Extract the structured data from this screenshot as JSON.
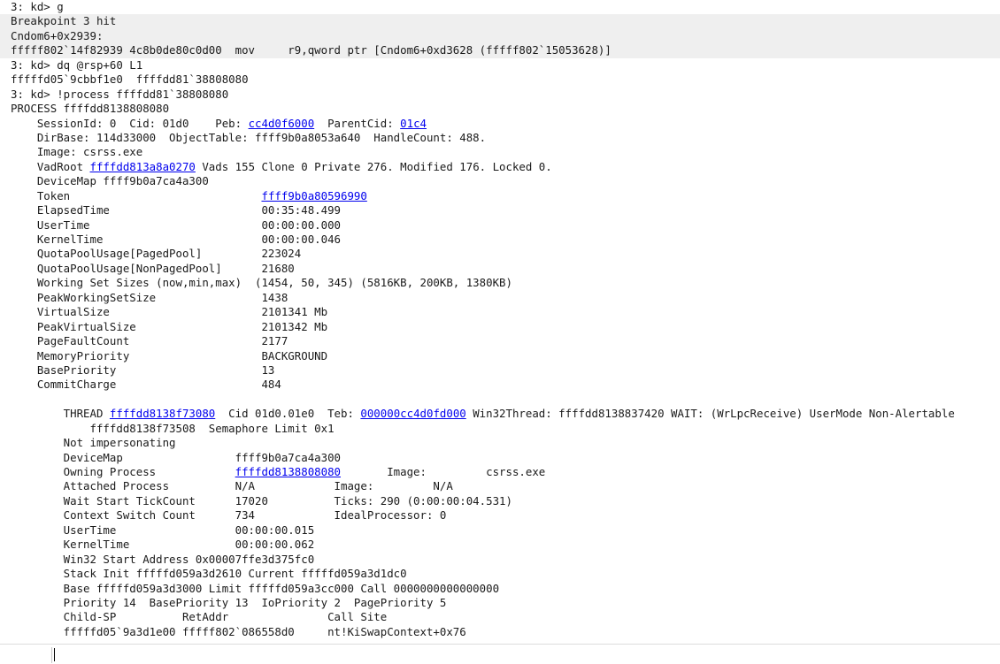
{
  "output_lines": [
    {
      "hl": false,
      "segs": [
        {
          "t": "3: kd> g"
        }
      ]
    },
    {
      "hl": true,
      "segs": [
        {
          "t": "Breakpoint 3 hit"
        }
      ]
    },
    {
      "hl": true,
      "segs": [
        {
          "t": "Cndom6+0x2939:"
        }
      ]
    },
    {
      "hl": true,
      "segs": [
        {
          "t": "fffff802`14f82939 4c8b0de80c0d00  mov     r9,qword ptr [Cndom6+0xd3628 (fffff802`15053628)]"
        }
      ]
    },
    {
      "hl": false,
      "segs": [
        {
          "t": "3: kd> dq @rsp+60 L1"
        }
      ]
    },
    {
      "hl": false,
      "segs": [
        {
          "t": "fffffd05`9cbbf1e0  ffffdd81`38808080"
        }
      ]
    },
    {
      "hl": false,
      "segs": [
        {
          "t": "3: kd> !process ffffdd81`38808080"
        }
      ]
    },
    {
      "hl": false,
      "segs": [
        {
          "t": "PROCESS ffffdd8138808080"
        }
      ]
    },
    {
      "hl": false,
      "segs": [
        {
          "t": "    SessionId: 0  Cid: 01d0    Peb: "
        },
        {
          "t": "cc4d0f6000",
          "link": true
        },
        {
          "t": "  ParentCid: "
        },
        {
          "t": "01c4",
          "link": true
        }
      ]
    },
    {
      "hl": false,
      "segs": [
        {
          "t": "    DirBase: 114d33000  ObjectTable: ffff9b0a8053a640  HandleCount: 488."
        }
      ]
    },
    {
      "hl": false,
      "segs": [
        {
          "t": "    Image: csrss.exe"
        }
      ]
    },
    {
      "hl": false,
      "segs": [
        {
          "t": "    VadRoot "
        },
        {
          "t": "ffffdd813a8a0270",
          "link": true
        },
        {
          "t": " Vads 155 Clone 0 Private 276. Modified 176. Locked 0."
        }
      ]
    },
    {
      "hl": false,
      "segs": [
        {
          "t": "    DeviceMap ffff9b0a7ca4a300"
        }
      ]
    },
    {
      "hl": false,
      "segs": [
        {
          "t": "    Token                             "
        },
        {
          "t": "ffff9b0a80596990",
          "link": true
        }
      ]
    },
    {
      "hl": false,
      "segs": [
        {
          "t": "    ElapsedTime                       00:35:48.499"
        }
      ]
    },
    {
      "hl": false,
      "segs": [
        {
          "t": "    UserTime                          00:00:00.000"
        }
      ]
    },
    {
      "hl": false,
      "segs": [
        {
          "t": "    KernelTime                        00:00:00.046"
        }
      ]
    },
    {
      "hl": false,
      "segs": [
        {
          "t": "    QuotaPoolUsage[PagedPool]         223024"
        }
      ]
    },
    {
      "hl": false,
      "segs": [
        {
          "t": "    QuotaPoolUsage[NonPagedPool]      21680"
        }
      ]
    },
    {
      "hl": false,
      "segs": [
        {
          "t": "    Working Set Sizes (now,min,max)  (1454, 50, 345) (5816KB, 200KB, 1380KB)"
        }
      ]
    },
    {
      "hl": false,
      "segs": [
        {
          "t": "    PeakWorkingSetSize                1438"
        }
      ]
    },
    {
      "hl": false,
      "segs": [
        {
          "t": "    VirtualSize                       2101341 Mb"
        }
      ]
    },
    {
      "hl": false,
      "segs": [
        {
          "t": "    PeakVirtualSize                   2101342 Mb"
        }
      ]
    },
    {
      "hl": false,
      "segs": [
        {
          "t": "    PageFaultCount                    2177"
        }
      ]
    },
    {
      "hl": false,
      "segs": [
        {
          "t": "    MemoryPriority                    BACKGROUND"
        }
      ]
    },
    {
      "hl": false,
      "segs": [
        {
          "t": "    BasePriority                      13"
        }
      ]
    },
    {
      "hl": false,
      "segs": [
        {
          "t": "    CommitCharge                      484"
        }
      ]
    },
    {
      "hl": false,
      "segs": [
        {
          "t": ""
        }
      ]
    },
    {
      "hl": false,
      "segs": [
        {
          "t": "        THREAD "
        },
        {
          "t": "ffffdd8138f73080",
          "link": true
        },
        {
          "t": "  Cid 01d0.01e0  Teb: "
        },
        {
          "t": "000000cc4d0fd000",
          "link": true
        },
        {
          "t": " Win32Thread: ffffdd8138837420 WAIT: (WrLpcReceive) UserMode Non-Alertable"
        }
      ]
    },
    {
      "hl": false,
      "segs": [
        {
          "t": "            ffffdd8138f73508  Semaphore Limit 0x1"
        }
      ]
    },
    {
      "hl": false,
      "segs": [
        {
          "t": "        Not impersonating"
        }
      ]
    },
    {
      "hl": false,
      "segs": [
        {
          "t": "        DeviceMap                 ffff9b0a7ca4a300"
        }
      ]
    },
    {
      "hl": false,
      "segs": [
        {
          "t": "        Owning Process            "
        },
        {
          "t": "ffffdd8138808080",
          "link": true
        },
        {
          "t": "       Image:         csrss.exe"
        }
      ]
    },
    {
      "hl": false,
      "segs": [
        {
          "t": "        Attached Process          N/A            Image:         N/A"
        }
      ]
    },
    {
      "hl": false,
      "segs": [
        {
          "t": "        Wait Start TickCount      17020          Ticks: 290 (0:00:00:04.531)"
        }
      ]
    },
    {
      "hl": false,
      "segs": [
        {
          "t": "        Context Switch Count      734            IdealProcessor: 0"
        }
      ]
    },
    {
      "hl": false,
      "segs": [
        {
          "t": "        UserTime                  00:00:00.015"
        }
      ]
    },
    {
      "hl": false,
      "segs": [
        {
          "t": "        KernelTime                00:00:00.062"
        }
      ]
    },
    {
      "hl": false,
      "segs": [
        {
          "t": "        Win32 Start Address 0x00007ffe3d375fc0"
        }
      ]
    },
    {
      "hl": false,
      "segs": [
        {
          "t": "        Stack Init fffffd059a3d2610 Current fffffd059a3d1dc0"
        }
      ]
    },
    {
      "hl": false,
      "segs": [
        {
          "t": "        Base fffffd059a3d3000 Limit fffffd059a3cc000 Call 0000000000000000"
        }
      ]
    },
    {
      "hl": false,
      "segs": [
        {
          "t": "        Priority 14  BasePriority 13  IoPriority 2  PagePriority 5"
        }
      ]
    },
    {
      "hl": false,
      "segs": [
        {
          "t": "        Child-SP          RetAddr               Call Site"
        }
      ]
    },
    {
      "hl": false,
      "segs": [
        {
          "t": "        fffffd05`9a3d1e00 fffff802`086558d0     nt!KiSwapContext+0x76"
        }
      ]
    }
  ],
  "command": {
    "value": ""
  }
}
